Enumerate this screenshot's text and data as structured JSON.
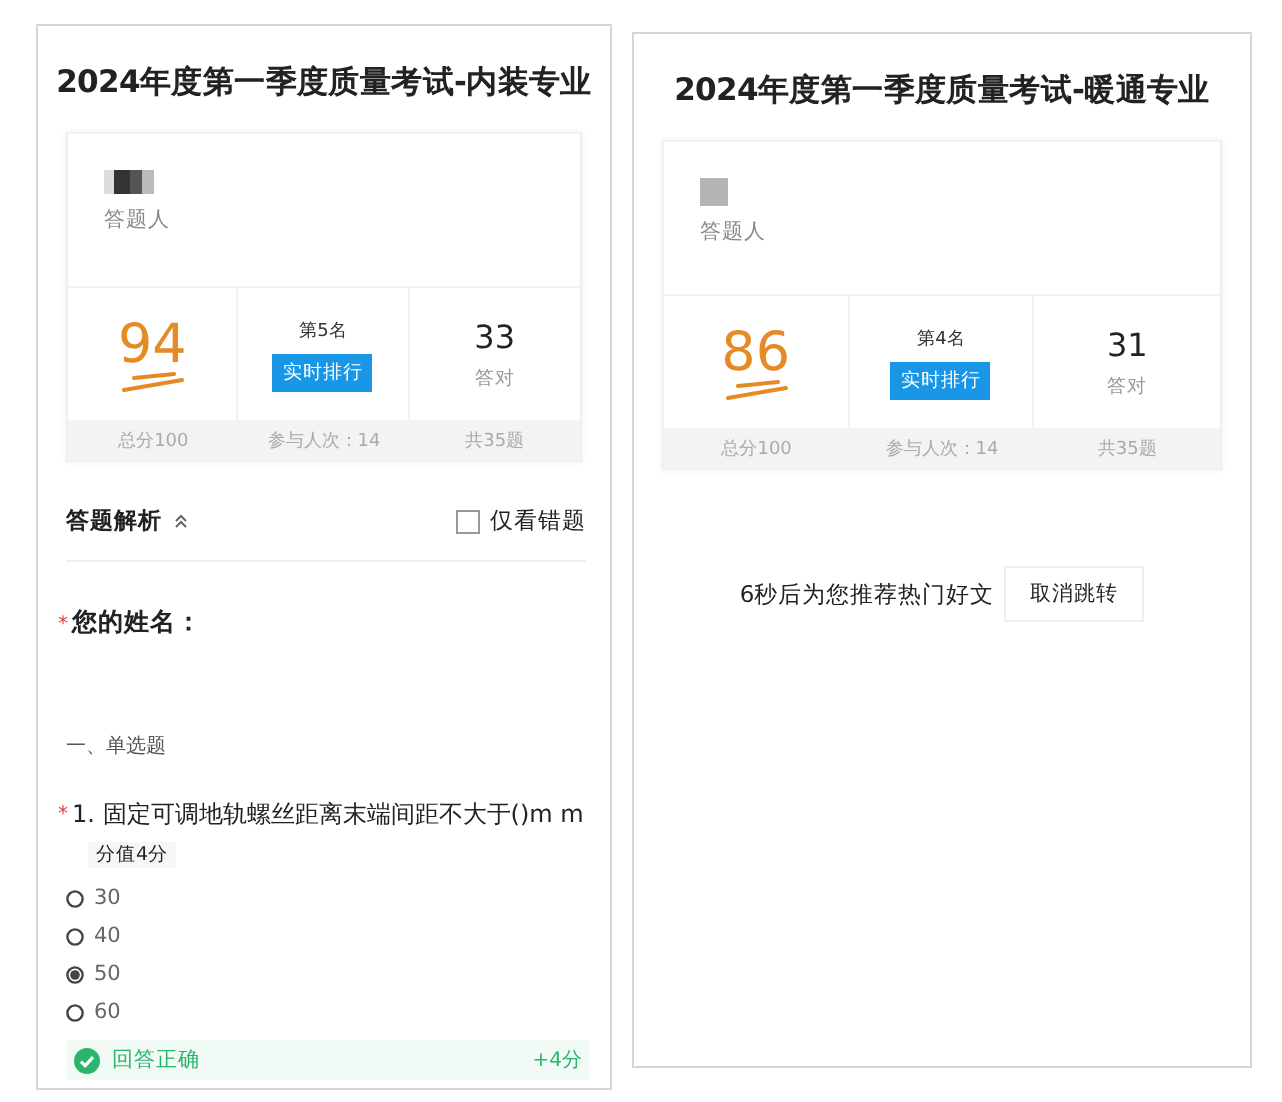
{
  "panels": [
    {
      "kind": "analysis",
      "title": "2024年度第一季度质量考试-内装专业",
      "respondent_label": "答题人",
      "score": "94",
      "rank": "第5名",
      "rank_button": "实时排行",
      "correct_count": "33",
      "correct_label": "答对",
      "total_score": "总分100",
      "participants": "参与人次：14",
      "total_questions": "共35题",
      "analysis": {
        "label": "答题解析",
        "expanded": true,
        "filter": {
          "label": "仅看错题",
          "checked": false
        }
      },
      "name_question": {
        "required_mark": "*",
        "label": "您的姓名："
      },
      "section": "一、单选题",
      "question": {
        "required_mark": "*",
        "text": "1. 固定可调地轨螺丝距离末端间距不大于()m m",
        "points": "分值4分",
        "options": [
          {
            "label": "30",
            "selected": false
          },
          {
            "label": "40",
            "selected": false
          },
          {
            "label": "50",
            "selected": true
          },
          {
            "label": "60",
            "selected": false
          }
        ],
        "result": {
          "label": "回答正确",
          "correct": true,
          "score": "+4分"
        }
      }
    },
    {
      "kind": "redirect",
      "title": "2024年度第一季度质量考试-暖通专业",
      "respondent_label": "答题人",
      "score": "86",
      "rank": "第4名",
      "rank_button": "实时排行",
      "correct_count": "31",
      "correct_label": "答对",
      "total_score": "总分100",
      "participants": "参与人次：14",
      "total_questions": "共35题",
      "countdown": "6秒后为您推荐热门好文",
      "cancel_button": "取消跳转"
    }
  ]
}
